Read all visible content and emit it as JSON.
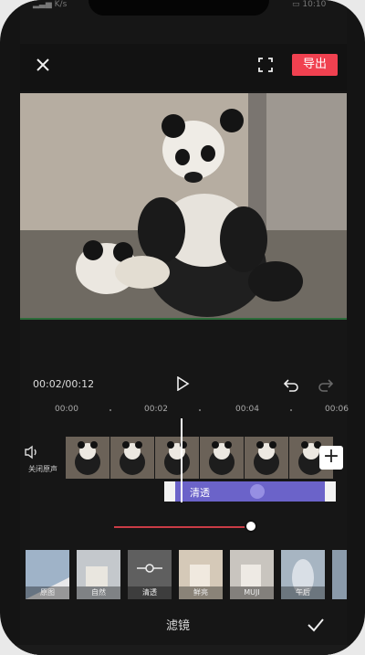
{
  "status": {
    "carrier": "K/s",
    "time": "10:10"
  },
  "topbar": {
    "export_label": "导出"
  },
  "playback": {
    "current_time": "00:02",
    "total_time": "00:12"
  },
  "timeline": {
    "ticks": [
      "00:00",
      "00:02",
      "00:04",
      "00:06"
    ]
  },
  "audio": {
    "label": "关闭原声"
  },
  "filter_bar": {
    "label": "清透"
  },
  "filters": [
    {
      "label": "原图"
    },
    {
      "label": "自然"
    },
    {
      "label": "清透"
    },
    {
      "label": "鲜亮"
    },
    {
      "label": "MUJI"
    },
    {
      "label": "午后"
    }
  ],
  "bottom": {
    "title": "滤镜"
  },
  "colors": {
    "accent": "#f04150",
    "filter_bar": "#6b63c9",
    "slider": "#c93c45"
  }
}
